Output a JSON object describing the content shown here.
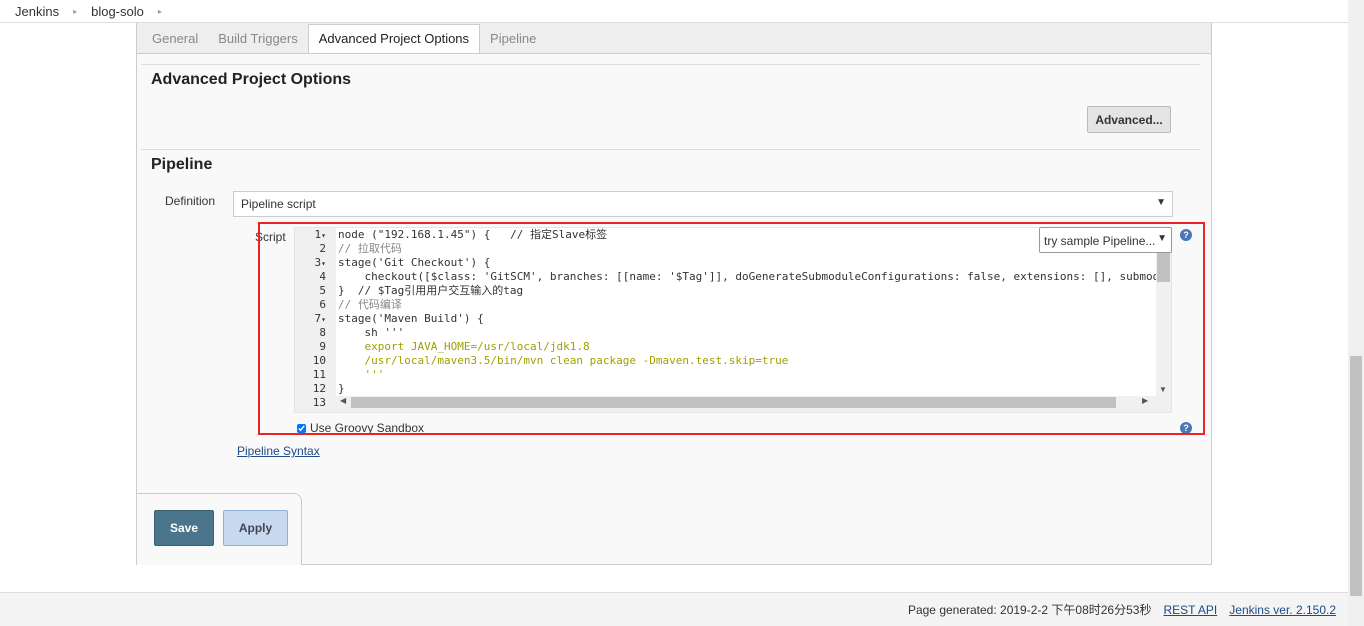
{
  "breadcrumb": [
    "Jenkins",
    "blog-solo"
  ],
  "tabs": [
    "General",
    "Build Triggers",
    "Advanced Project Options",
    "Pipeline"
  ],
  "active_tab": "Advanced Project Options",
  "advanced_section": {
    "title": "Advanced Project Options",
    "advanced_button": "Advanced..."
  },
  "pipeline": {
    "title": "Pipeline",
    "definition_label": "Definition",
    "definition_value": "Pipeline script",
    "script_label": "Script",
    "sample_select": "try sample Pipeline...",
    "line_numbers": [
      "1",
      "2",
      "3",
      "4",
      "5",
      "6",
      "7",
      "8",
      "9",
      "10",
      "11",
      "12",
      "13"
    ],
    "code_lines": [
      "node (\"192.168.1.45\") {   // 指定Slave标签",
      "// 拉取代码",
      "stage('Git Checkout') {",
      "    checkout([$class: 'GitSCM', branches: [[name: '$Tag']], doGenerateSubmoduleConfigurations: false, extensions: [], submod",
      "}  // $Tag引用用户交互输入的tag",
      "// 代码编译",
      "stage('Maven Build') {",
      "    sh '''",
      "    export JAVA_HOME=/usr/local/jdk1.8",
      "    /usr/local/maven3.5/bin/mvn clean package -Dmaven.test.skip=true",
      "    '''",
      "}",
      ""
    ],
    "sandbox_label": "Use Groovy Sandbox",
    "sandbox_checked": true,
    "syntax_link": "Pipeline Syntax"
  },
  "buttons": {
    "save": "Save",
    "apply": "Apply"
  },
  "footer": {
    "generated": "Page generated: 2019-2-2 下午08时26分53秒",
    "rest_api": "REST API",
    "version": "Jenkins ver. 2.150.2"
  },
  "colors": {
    "highlight_box": "#ee2222",
    "save_button": "#4b758b",
    "apply_button": "#c7d9ee"
  }
}
